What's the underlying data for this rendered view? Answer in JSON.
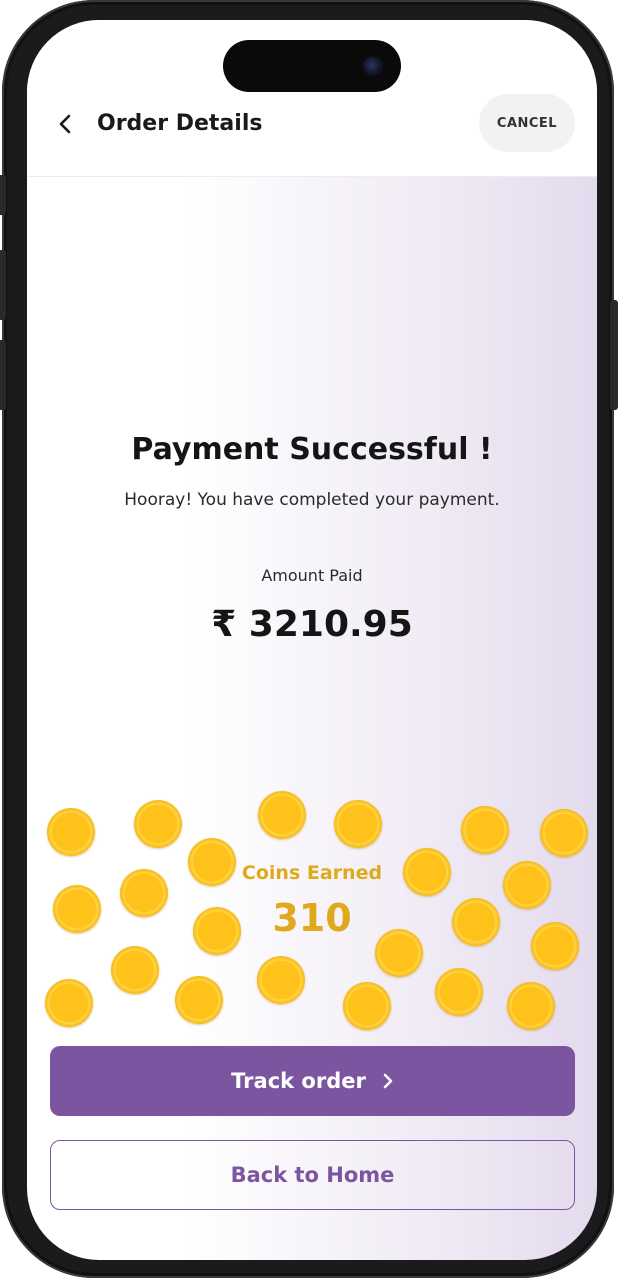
{
  "header": {
    "title": "Order Details",
    "cancel_label": "CANCEL"
  },
  "success": {
    "title": "Payment Successful !",
    "subtitle": "Hooray! You have completed your payment."
  },
  "amount": {
    "label": "Amount Paid",
    "value": "₹ 3210.95"
  },
  "coins": {
    "label": "Coins Earned",
    "value": "310"
  },
  "actions": {
    "track_label": "Track order",
    "home_label": "Back to Home"
  },
  "colors": {
    "accent": "#7c55a1",
    "coin_text": "#e0a81b",
    "coin": "#ffc21a"
  },
  "icons": {
    "back": "chevron-left-icon",
    "track": "chevron-right-icon",
    "coin": "coin-icon"
  }
}
